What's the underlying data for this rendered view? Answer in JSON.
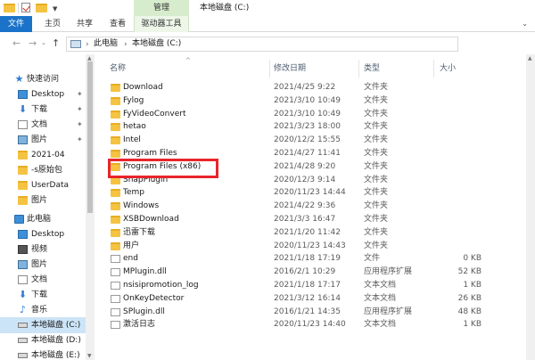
{
  "titlebar": {
    "contextual_tab_group": "管理",
    "window_title": "本地磁盘 (C:)"
  },
  "ribbon": {
    "tabs": [
      {
        "label": "文件"
      },
      {
        "label": "主页"
      },
      {
        "label": "共享"
      },
      {
        "label": "查看"
      },
      {
        "label": "驱动器工具"
      }
    ]
  },
  "address": {
    "crumbs": [
      "此电脑",
      "本地磁盘 (C:)"
    ]
  },
  "navpane": {
    "items": [
      {
        "label": "快速访问",
        "icon": "star-icon",
        "pinned": false
      },
      {
        "label": "Desktop",
        "icon": "desktop-icon",
        "pinned": true
      },
      {
        "label": "下载",
        "icon": "download-icon",
        "pinned": true
      },
      {
        "label": "文档",
        "icon": "document-icon",
        "pinned": true
      },
      {
        "label": "图片",
        "icon": "pictures-icon",
        "pinned": true
      },
      {
        "label": "2021-04",
        "icon": "folder-icon",
        "pinned": false
      },
      {
        "label": "-s原始包",
        "icon": "folder-icon",
        "pinned": false
      },
      {
        "label": "UserData",
        "icon": "folder-icon",
        "pinned": false
      },
      {
        "label": "图片",
        "icon": "folder-icon",
        "pinned": false
      },
      {
        "label": "此电脑",
        "icon": "computer-icon",
        "pinned": false
      },
      {
        "label": "Desktop",
        "icon": "desktop-icon",
        "pinned": false
      },
      {
        "label": "视频",
        "icon": "video-icon",
        "pinned": false
      },
      {
        "label": "图片",
        "icon": "pictures-icon",
        "pinned": false
      },
      {
        "label": "文档",
        "icon": "document-icon",
        "pinned": false
      },
      {
        "label": "下载",
        "icon": "download-icon",
        "pinned": false
      },
      {
        "label": "音乐",
        "icon": "music-icon",
        "pinned": false
      },
      {
        "label": "本地磁盘 (C:)",
        "icon": "drive-icon",
        "pinned": false,
        "selected": true
      },
      {
        "label": "本地磁盘 (D:)",
        "icon": "drive-icon",
        "pinned": false
      },
      {
        "label": "本地磁盘 (E:)",
        "icon": "drive-icon",
        "pinned": false
      }
    ]
  },
  "columns": {
    "name": "名称",
    "date": "修改日期",
    "type": "类型",
    "size": "大小"
  },
  "files": [
    {
      "name": "Download",
      "date": "2021/4/25 9:22",
      "type": "文件夹",
      "size": "",
      "kind": "folder"
    },
    {
      "name": "Fylog",
      "date": "2021/3/10 10:49",
      "type": "文件夹",
      "size": "",
      "kind": "folder"
    },
    {
      "name": "FyVideoConvert",
      "date": "2021/3/10 10:49",
      "type": "文件夹",
      "size": "",
      "kind": "folder"
    },
    {
      "name": "hetao",
      "date": "2021/3/23 18:00",
      "type": "文件夹",
      "size": "",
      "kind": "folder"
    },
    {
      "name": "Intel",
      "date": "2020/12/2 15:55",
      "type": "文件夹",
      "size": "",
      "kind": "folder"
    },
    {
      "name": "Program Files",
      "date": "2021/4/27 11:41",
      "type": "文件夹",
      "size": "",
      "kind": "folder"
    },
    {
      "name": "Program Files (x86)",
      "date": "2021/4/28 9:20",
      "type": "文件夹",
      "size": "",
      "kind": "folder"
    },
    {
      "name": "SnapPlugin",
      "date": "2020/12/3 9:14",
      "type": "文件夹",
      "size": "",
      "kind": "folder"
    },
    {
      "name": "Temp",
      "date": "2020/11/23 14:44",
      "type": "文件夹",
      "size": "",
      "kind": "folder"
    },
    {
      "name": "Windows",
      "date": "2021/4/22 9:36",
      "type": "文件夹",
      "size": "",
      "kind": "folder"
    },
    {
      "name": "XSBDownload",
      "date": "2021/3/3 16:47",
      "type": "文件夹",
      "size": "",
      "kind": "folder"
    },
    {
      "name": "迅雷下载",
      "date": "2021/1/20 11:42",
      "type": "文件夹",
      "size": "",
      "kind": "folder"
    },
    {
      "name": "用户",
      "date": "2020/11/23 14:43",
      "type": "文件夹",
      "size": "",
      "kind": "folder"
    },
    {
      "name": "end",
      "date": "2021/1/18 17:19",
      "type": "文件",
      "size": "0 KB",
      "kind": "file"
    },
    {
      "name": "MPlugin.dll",
      "date": "2016/2/1 10:29",
      "type": "应用程序扩展",
      "size": "52 KB",
      "kind": "file"
    },
    {
      "name": "nsisipromotion_log",
      "date": "2021/1/18 17:17",
      "type": "文本文档",
      "size": "1 KB",
      "kind": "file"
    },
    {
      "name": "OnKeyDetector",
      "date": "2021/3/12 16:14",
      "type": "文本文档",
      "size": "26 KB",
      "kind": "file"
    },
    {
      "name": "SPlugin.dll",
      "date": "2016/1/21 14:35",
      "type": "应用程序扩展",
      "size": "48 KB",
      "kind": "file"
    },
    {
      "name": "激活日志",
      "date": "2020/11/23 14:40",
      "type": "文本文档",
      "size": "1 KB",
      "kind": "file"
    }
  ],
  "colors": {
    "file_tab": "#1a73c9",
    "manage_group": "#d7eccc",
    "folder": "#f5c342",
    "selection": "#cce4f7",
    "highlight_box": "#e8252b"
  }
}
